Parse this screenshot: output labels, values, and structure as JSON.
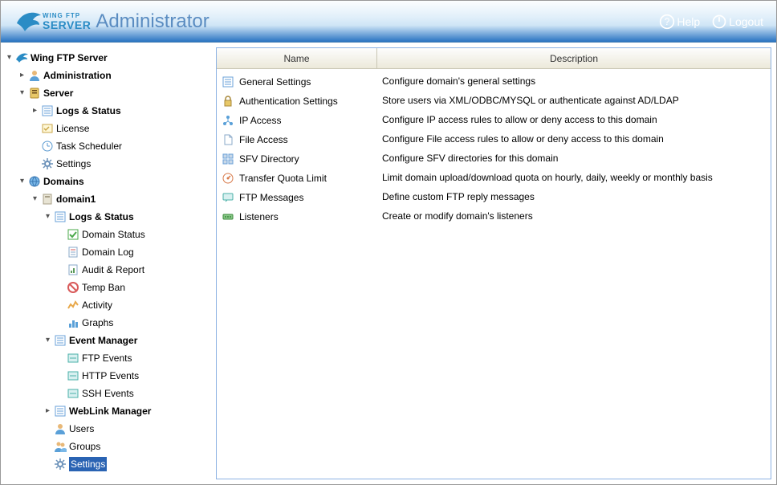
{
  "header": {
    "brand_wing": "WING FTP",
    "brand_server": "SERVER",
    "app_title": "Administrator",
    "help_label": "Help",
    "logout_label": "Logout"
  },
  "tree": {
    "root": "Wing FTP Server",
    "administration": "Administration",
    "server": "Server",
    "server_logs_status": "Logs & Status",
    "server_license": "License",
    "server_task_scheduler": "Task Scheduler",
    "server_settings": "Settings",
    "domains": "Domains",
    "domain1": "domain1",
    "domain_logs_status": "Logs & Status",
    "domain_status": "Domain Status",
    "domain_log": "Domain Log",
    "audit_report": "Audit & Report",
    "temp_ban": "Temp Ban",
    "activity": "Activity",
    "graphs": "Graphs",
    "event_manager": "Event Manager",
    "ftp_events": "FTP Events",
    "http_events": "HTTP Events",
    "ssh_events": "SSH Events",
    "weblink_manager": "WebLink Manager",
    "users": "Users",
    "groups": "Groups",
    "domain_settings": "Settings"
  },
  "table": {
    "col_name": "Name",
    "col_desc": "Description",
    "rows": [
      {
        "name": "General Settings",
        "desc": "Configure domain's general settings"
      },
      {
        "name": "Authentication Settings",
        "desc": "Store users via XML/ODBC/MYSQL or authenticate against AD/LDAP"
      },
      {
        "name": "IP Access",
        "desc": "Configure IP access rules to allow or deny access to this domain"
      },
      {
        "name": "File Access",
        "desc": "Configure File access rules to allow or deny access to this domain"
      },
      {
        "name": "SFV Directory",
        "desc": "Configure SFV directories for this domain"
      },
      {
        "name": "Transfer Quota Limit",
        "desc": "Limit domain upload/download quota on hourly, daily, weekly or monthly basis"
      },
      {
        "name": "FTP Messages",
        "desc": "Define custom FTP reply messages"
      },
      {
        "name": "Listeners",
        "desc": "Create or modify domain's listeners"
      }
    ]
  }
}
